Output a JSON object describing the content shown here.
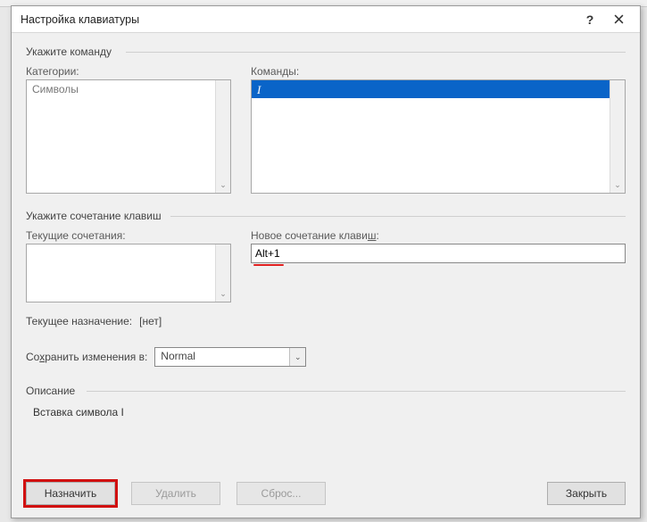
{
  "dialog": {
    "title": "Настройка клавиатуры"
  },
  "section_command": {
    "label": "Укажите команду"
  },
  "categories": {
    "label": "Категории:",
    "items": [
      "Символы"
    ]
  },
  "commands": {
    "label": "Команды:",
    "items": [
      "I"
    ],
    "selected_index": 0
  },
  "section_shortcut": {
    "label": "Укажите сочетание клавиш"
  },
  "current_shortcuts": {
    "label": "Текущие сочетания:",
    "items": []
  },
  "new_shortcut": {
    "label_prefix": "Новое сочетание клави",
    "label_underlined": "ш",
    "label_suffix": ":",
    "value": "Alt+1"
  },
  "current_assignment": {
    "label": "Текущее назначение:",
    "value": "[нет]"
  },
  "save_changes": {
    "label_prefix": "Со",
    "label_underlined": "х",
    "label_suffix": "ранить изменения в:",
    "value": "Normal"
  },
  "description": {
    "label": "Описание",
    "text": "Вставка символа I"
  },
  "buttons": {
    "assign": "Назначить",
    "delete": "Удалить",
    "reset": "Сброс...",
    "close": "Закрыть"
  }
}
